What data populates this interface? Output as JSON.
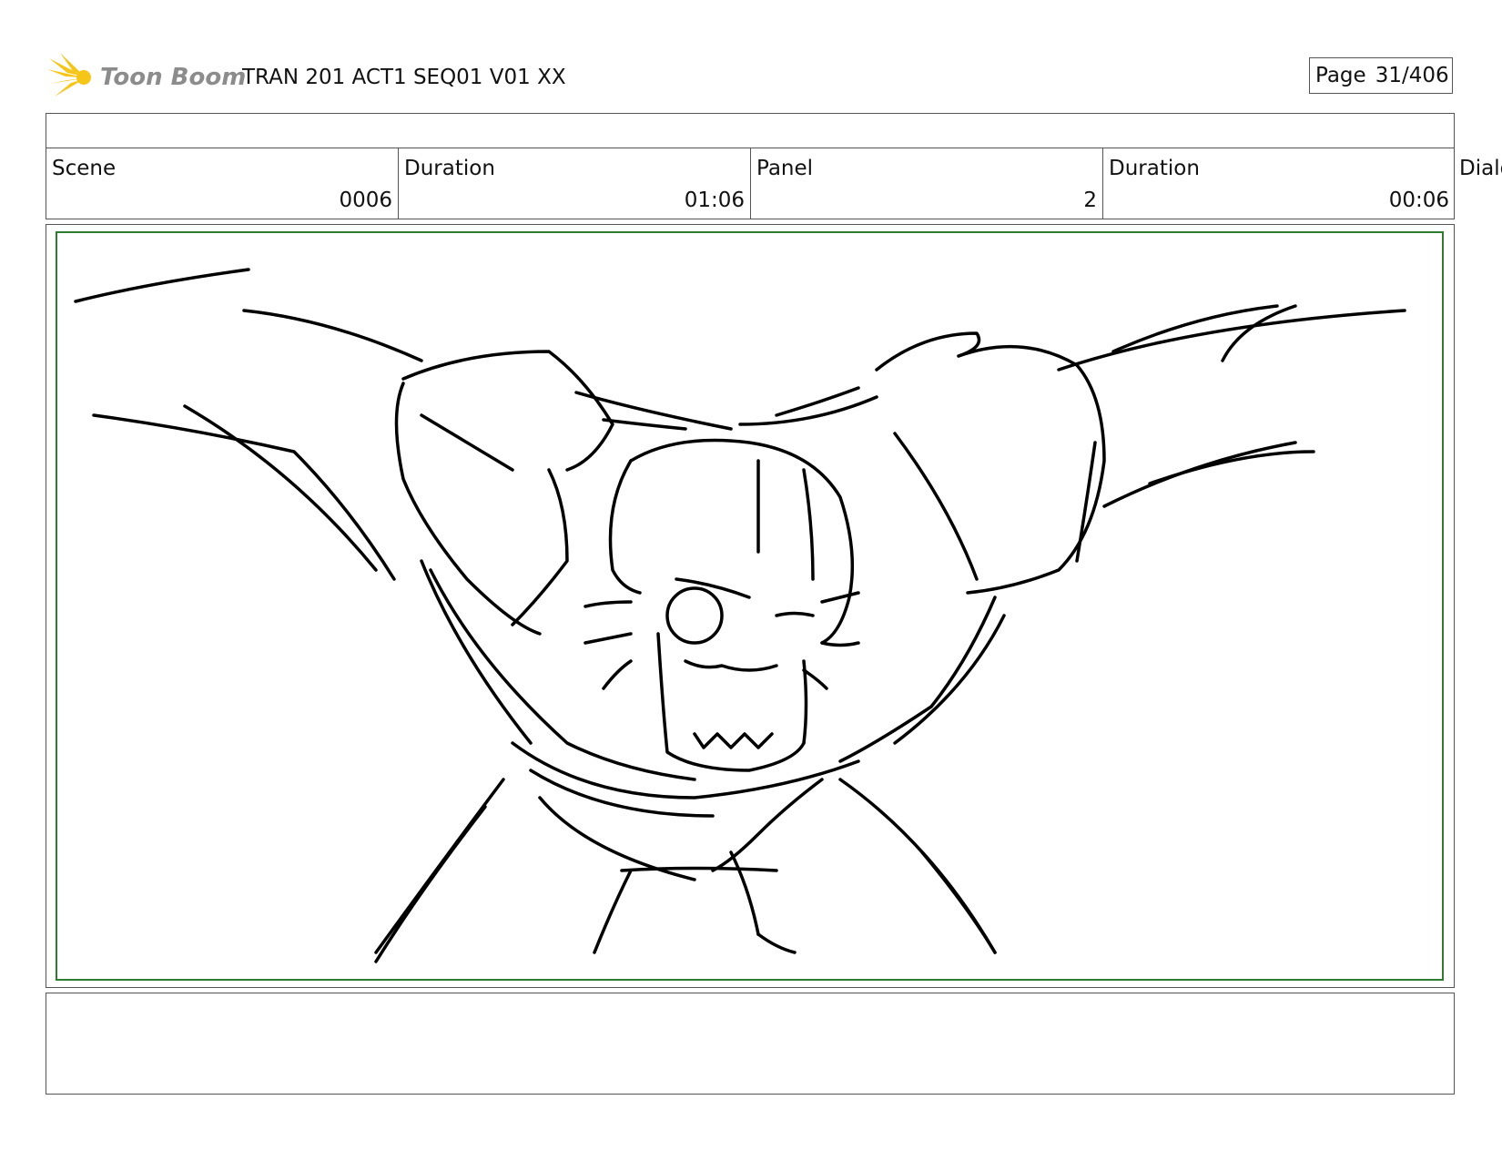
{
  "header": {
    "logo_text": "Toon Boom",
    "project_title": "TRAN 201 ACT1 SEQ01 V01 XX",
    "page_label": "Page",
    "page_number": "31/406"
  },
  "info_row": {
    "scene_label": "Scene",
    "scene_value": "0006",
    "scene_duration_label": "Duration",
    "scene_duration_value": "01:06",
    "panel_label": "Panel",
    "panel_value": "2",
    "panel_duration_label": "Duration",
    "panel_duration_value": "00:06",
    "dialog_label": "Dialog"
  },
  "panel": {
    "image_icon": "storyboard-sketch",
    "frame_color": "#2e7d2e"
  },
  "notes": {
    "text": ""
  },
  "colors": {
    "logo_yellow": "#f5c518",
    "logo_text": "#8c8c8c",
    "border": "#555555"
  }
}
